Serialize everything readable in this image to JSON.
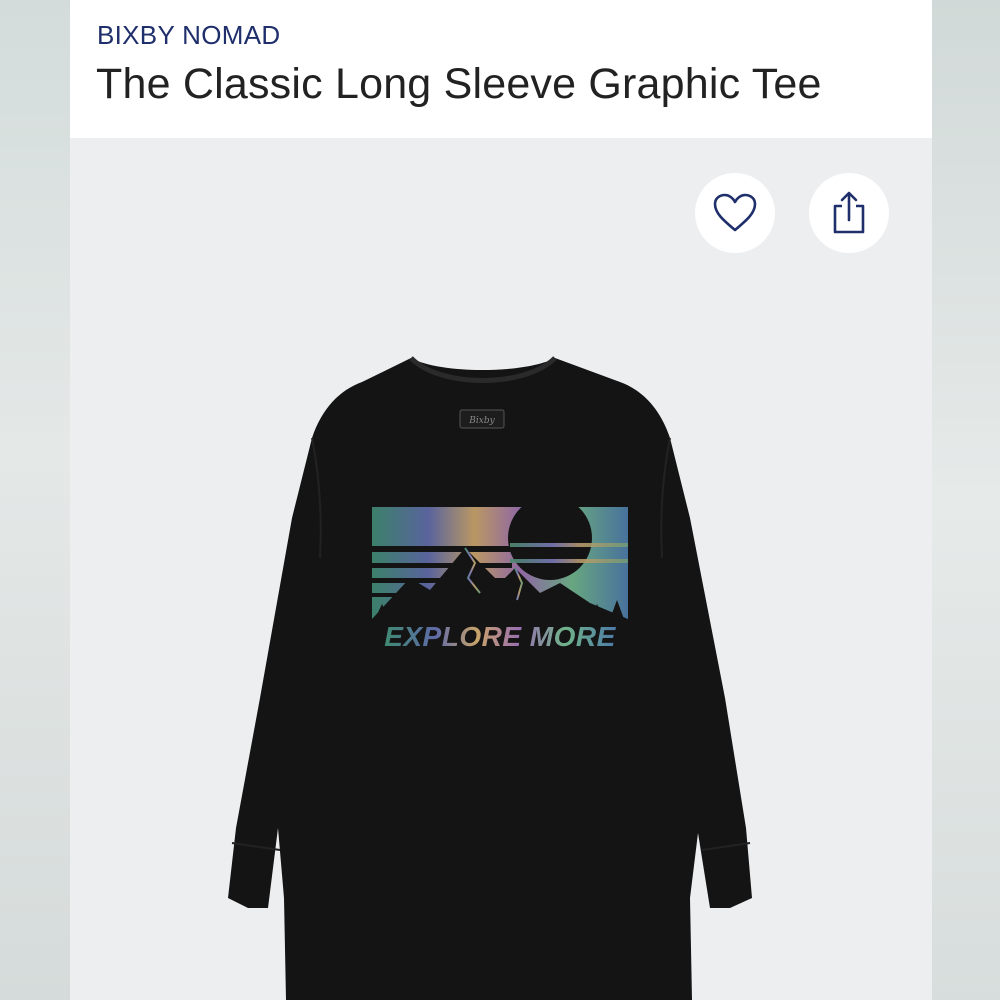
{
  "product": {
    "brand": "BIXBY NOMAD",
    "title": "The Classic Long Sleeve Graphic Tee"
  },
  "actions": {
    "favorite_icon": "heart-icon",
    "share_icon": "share-icon"
  },
  "image": {
    "graphic_text": "EXPLORE MORE",
    "neck_label": "Bixby",
    "shirt_color": "#141414"
  },
  "colors": {
    "brand": "#1f2f6b",
    "title": "#222222",
    "header_bg": "#ffffff",
    "image_bg": "#eceef0"
  }
}
